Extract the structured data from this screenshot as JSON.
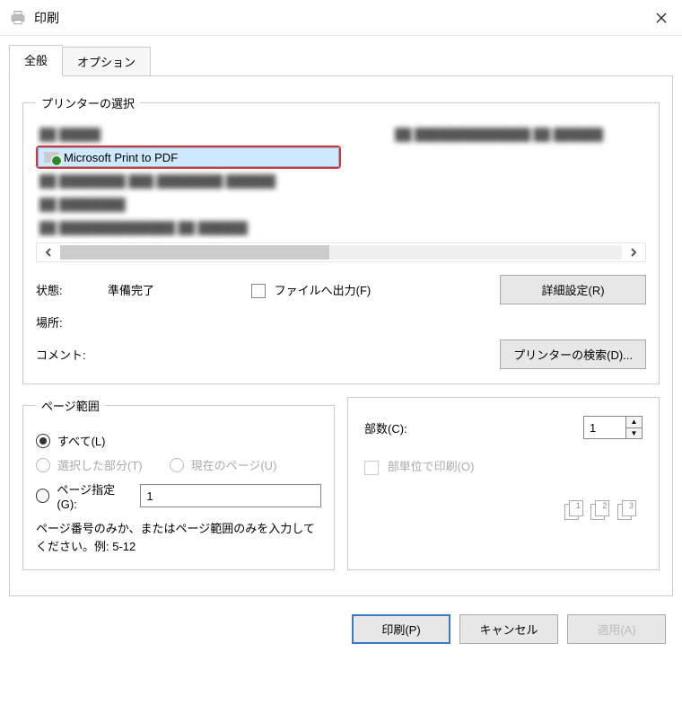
{
  "title": "印刷",
  "tabs": {
    "general": "全般",
    "options": "オプション"
  },
  "printer": {
    "legend": "プリンターの選択",
    "selected": "Microsoft Print to PDF"
  },
  "status": {
    "state_label": "状態:",
    "state_value": "準備完了",
    "location_label": "場所:",
    "comment_label": "コメント:",
    "to_file_label": "ファイルへ出力(F)",
    "prefs_btn": "詳細設定(R)",
    "find_btn": "プリンターの検索(D)..."
  },
  "range": {
    "legend": "ページ範囲",
    "all": "すべて(L)",
    "selection": "選択した部分(T)",
    "current": "現在のページ(U)",
    "pages_label": "ページ指定(G):",
    "pages_value": "1",
    "hint": "ページ番号のみか、またはページ範囲のみを入力してください。例: 5-12"
  },
  "copies": {
    "label": "部数(C):",
    "value": "1",
    "collate": "部単位で印刷(O)",
    "stacks": [
      "1",
      "1",
      "2",
      "2",
      "3",
      "3"
    ]
  },
  "footer": {
    "print": "印刷(P)",
    "cancel": "キャンセル",
    "apply": "適用(A)"
  }
}
